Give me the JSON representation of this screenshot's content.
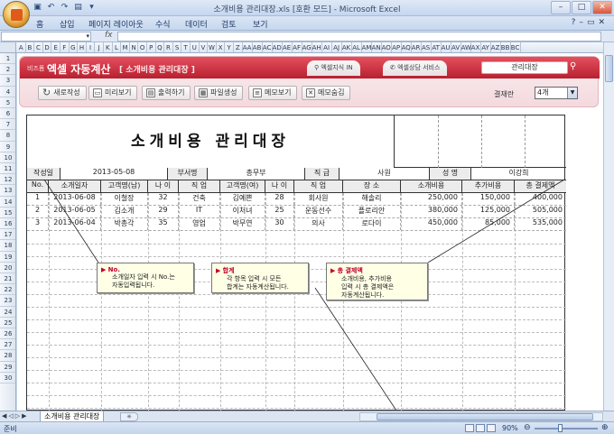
{
  "window": {
    "title": "소개비용 관리대장.xls  [호환 모드]  -  Microsoft Excel"
  },
  "ribbon_tabs": [
    "홈",
    "삽입",
    "페이지 레이아웃",
    "수식",
    "데이터",
    "검토",
    "보기"
  ],
  "formula_bar": {
    "fx": "fx",
    "name_box": "",
    "content": ""
  },
  "columns": [
    "A",
    "B",
    "C",
    "D",
    "E",
    "F",
    "G",
    "H",
    "I",
    "J",
    "K",
    "L",
    "M",
    "N",
    "O",
    "P",
    "Q",
    "R",
    "S",
    "T",
    "U",
    "V",
    "W",
    "X",
    "Y",
    "Z",
    "AA",
    "AB",
    "AC",
    "AD",
    "AE",
    "AF",
    "AG",
    "AH",
    "AI",
    "AJ",
    "AK",
    "AL",
    "AM",
    "AN",
    "AO",
    "AP",
    "AQ",
    "AR",
    "AS",
    "AT",
    "AU",
    "AV",
    "AW",
    "AX",
    "AY",
    "AZ",
    "BB",
    "BC"
  ],
  "rows": [
    "1",
    "2",
    "3",
    "4",
    "5",
    "6",
    "7",
    "8",
    "9",
    "10",
    "11",
    "12",
    "13",
    "14",
    "15",
    "16",
    "17",
    "18",
    "19",
    "20",
    "21",
    "22",
    "23",
    "24",
    "25",
    "26",
    "27",
    "28",
    "29",
    "30"
  ],
  "banner": {
    "brand_small": "비즈폼",
    "brand_name": "엑셀 자동계산",
    "brand_sub": "[ 소개비용 관리대장 ]",
    "link1": "엑셀지식 IN",
    "link2": "엑셀상담 서비스",
    "search_box": "관리대장",
    "buttons": [
      "새로작성",
      "미리보기",
      "출력하기",
      "파일생성",
      "메모보기",
      "메모숨김"
    ],
    "search_label": "결재란",
    "search_select": "4개"
  },
  "report": {
    "title": "소개비용 관리대장",
    "info": {
      "date_label": "작성일",
      "date_value": "2013-05-08",
      "dept_label": "부서명",
      "dept_value": "총무부",
      "rank_label": "직 급",
      "rank_value": "사원",
      "name_label": "성 명",
      "name_value": "이강희"
    },
    "headers": [
      "No.",
      "소개일자",
      "고객명(남)",
      "나 이",
      "직  업",
      "고객명(여)",
      "나 이",
      "직  업",
      "장    소",
      "소개비용",
      "추가비용",
      "총 결제액"
    ],
    "rows": [
      [
        "1",
        "2013-06-08",
        "이철장",
        "32",
        "건축",
        "김예쁜",
        "28",
        "회사원",
        "해솔리",
        "250,000",
        "150,000",
        "400,000"
      ],
      [
        "2",
        "2013-06-05",
        "김소개",
        "29",
        "IT",
        "이처녀",
        "25",
        "운동선수",
        "플로리안",
        "380,000",
        "125,000",
        "505,000"
      ],
      [
        "3",
        "2013-06-04",
        "박총각",
        "35",
        "영업",
        "박무연",
        "30",
        "의사",
        "로다이",
        "450,000",
        "85,000",
        "535,000"
      ]
    ]
  },
  "callouts": [
    {
      "title": "No.",
      "line1": "소개일자 입력 시 No.는",
      "line2": "자동입력됩니다."
    },
    {
      "title": "합계",
      "line1": "각 항목 입력 시 모든",
      "line2": "합계는 자동계산됩니다."
    },
    {
      "title": "총 결제액",
      "line1": "소개비용, 추가비용",
      "line2": "입력 시 총 결제액은",
      "line3": "자동계산됩니다."
    }
  ],
  "sheet_tab": "소개비용 관리대장",
  "status": {
    "ready": "준비",
    "zoom": "90%"
  }
}
